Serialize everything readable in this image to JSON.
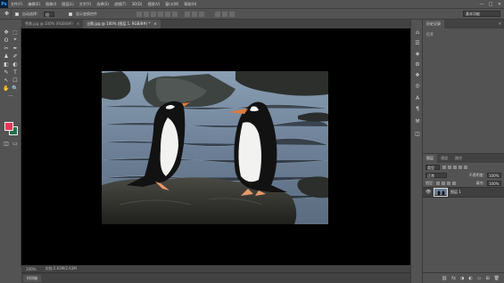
{
  "app": {
    "logo": "Ps"
  },
  "menu": [
    "文件(F)",
    "编辑(E)",
    "图像(I)",
    "图层(L)",
    "文字(Y)",
    "选择(S)",
    "滤镜(T)",
    "3D(D)",
    "视图(V)",
    "窗口(W)",
    "帮助(H)"
  ],
  "window_controls": {
    "minimize": "—",
    "maximize": "□",
    "close": "✕"
  },
  "options": {
    "tool_glyph": "✥",
    "auto_select_label": "自动选择：",
    "auto_select_value": "组",
    "transform_label": "显示变换控件",
    "workspace": "基本功能"
  },
  "tabs": [
    {
      "label": "雪景.jpg @ 100% (RGB/8#)",
      "close": "×"
    },
    {
      "label": "企鹅.jpg @ 100% (图层 1, RGB/8#) *",
      "close": "×"
    }
  ],
  "tools": [
    "✥",
    "⬚",
    "ʘ",
    "⌖",
    "✂",
    "✒",
    "♟",
    "✐",
    "◧",
    "◐",
    "✎",
    "T",
    "↖",
    "☐",
    "✋",
    "🔍",
    "···"
  ],
  "doc_status": {
    "zoom": "100%",
    "info": "文档:2.63M/2.63M"
  },
  "timeline": {
    "label": "时间轴"
  },
  "strip_icons": [
    "⌂",
    "☰",
    "◈",
    "⚙",
    "❖",
    "◎",
    "A",
    "¶",
    "⚒",
    "◫"
  ],
  "history_panel": {
    "title": "历史记录",
    "item": "打开",
    "collapse": "«"
  },
  "layers_panel": {
    "tabs": [
      "图层",
      "通道",
      "路径"
    ],
    "kind": "类型",
    "blend_mode": "正常",
    "opacity_label": "不透明度:",
    "opacity_value": "100%",
    "lock_label": "锁定:",
    "fill_label": "填充:",
    "fill_value": "100%",
    "layer_name": "图层 1",
    "footer_icons": [
      "⛓",
      "fx",
      "◑",
      "◐",
      "▭",
      "⊞",
      "🗑"
    ]
  },
  "colors": {
    "foreground": "#e8385a",
    "background": "#1f6e4a",
    "canvas": "#000000",
    "panel": "#535353"
  }
}
